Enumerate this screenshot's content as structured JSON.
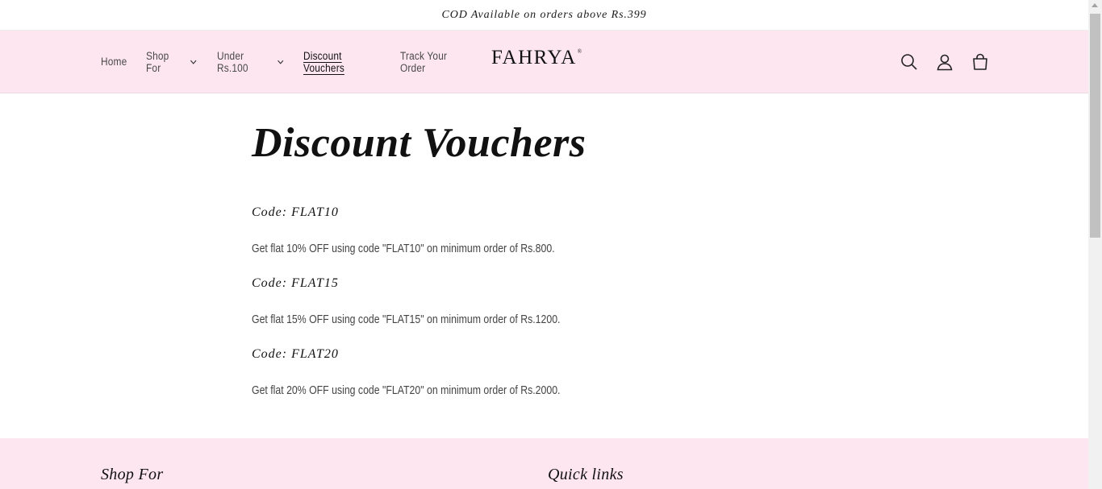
{
  "announcement": {
    "text": "COD Available on orders above Rs.399"
  },
  "nav": {
    "home": "Home",
    "shop_for": "Shop For",
    "under_100": "Under Rs.100",
    "discount_vouchers": "Discount Vouchers",
    "track_order": "Track Your Order"
  },
  "logo": {
    "text": "FAHRYA",
    "mark": "®"
  },
  "header_icons": [
    "search-icon",
    "account-icon",
    "cart-icon"
  ],
  "page": {
    "title": "Discount Vouchers",
    "vouchers": [
      {
        "code": "Code: FLAT10",
        "description": "Get flat 10% OFF using code \"FLAT10\" on minimum order of Rs.800."
      },
      {
        "code": "Code: FLAT15",
        "description": "Get flat 15% OFF using code \"FLAT15\" on minimum order of Rs.1200."
      },
      {
        "code": "Code: FLAT20",
        "description": "Get flat 20% OFF using code \"FLAT20\" on minimum order of Rs.2000."
      }
    ]
  },
  "footer": {
    "col1_title": "Shop For",
    "col2_title": "Quick links"
  },
  "colors": {
    "header_bg": "#fde6ef",
    "footer_bg": "#fde6ef",
    "text": "#121212"
  }
}
